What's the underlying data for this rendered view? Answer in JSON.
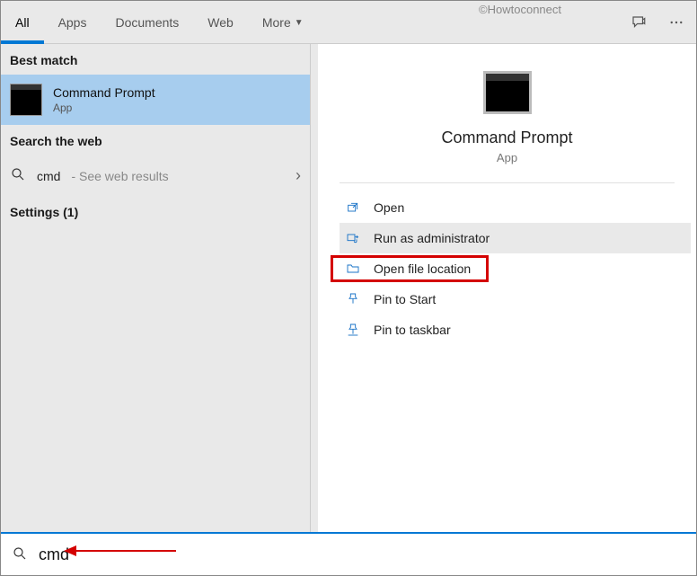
{
  "watermark": "©Howtoconnect",
  "tabs": {
    "all": "All",
    "apps": "Apps",
    "documents": "Documents",
    "web": "Web",
    "more": "More"
  },
  "left": {
    "best_match": "Best match",
    "result_title": "Command Prompt",
    "result_sub": "App",
    "search_web_hdr": "Search the web",
    "web_query": "cmd",
    "web_hint": "- See web results",
    "settings_label": "Settings (1)"
  },
  "detail": {
    "title": "Command Prompt",
    "sub": "App",
    "actions": {
      "open": "Open",
      "run_admin": "Run as administrator",
      "open_loc": "Open file location",
      "pin_start": "Pin to Start",
      "pin_taskbar": "Pin to taskbar"
    }
  },
  "search_value": "cmd"
}
